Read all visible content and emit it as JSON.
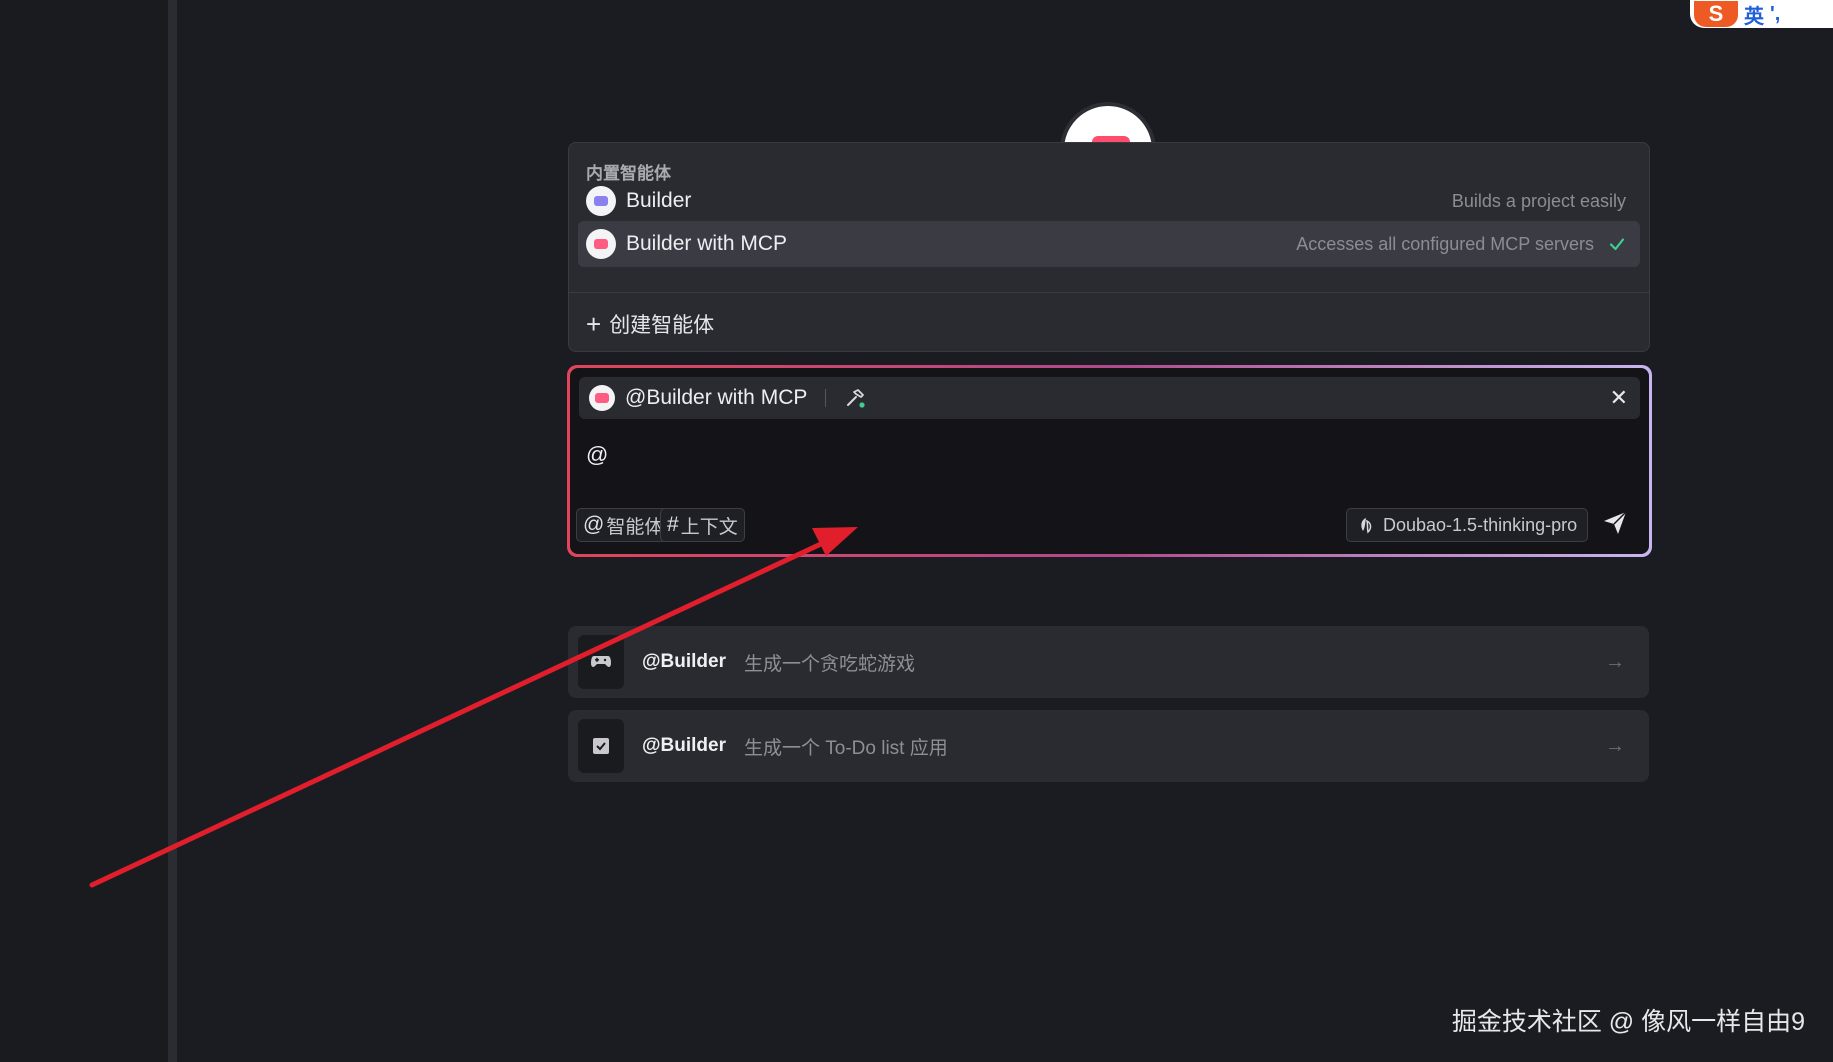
{
  "ime": {
    "mode": "英",
    "punct": "',"
  },
  "agent_menu": {
    "section_title": "内置智能体",
    "items": [
      {
        "name": "Builder",
        "description": "Builds a project easily",
        "selected": false
      },
      {
        "name": "Builder with MCP",
        "description": "Accesses all configured MCP servers",
        "selected": true
      }
    ],
    "create_label": "创建智能体"
  },
  "chat_input": {
    "selected_agent": "@Builder with MCP",
    "text": "@",
    "agent_tag": {
      "symbol": "@",
      "label": "智能体"
    },
    "context_tag": {
      "symbol": "#",
      "label": "上下文"
    },
    "model": "Doubao-1.5-thinking-pro"
  },
  "suggestions": [
    {
      "icon": "gamepad-icon",
      "agent": "@Builder",
      "text": "生成一个贪吃蛇游戏"
    },
    {
      "icon": "checkbox-icon",
      "agent": "@Builder",
      "text": "生成一个 To-Do list 应用"
    }
  ],
  "colors": {
    "background": "#1b1c21",
    "panel": "#2a2b31",
    "accent_check": "#3ecf8e",
    "annotation_arrow": "#e01e2c",
    "border_gradient_start": "#e0455a",
    "border_gradient_end": "#c8b6f0"
  },
  "watermark": "掘金技术社区 @ 像风一样自由9"
}
